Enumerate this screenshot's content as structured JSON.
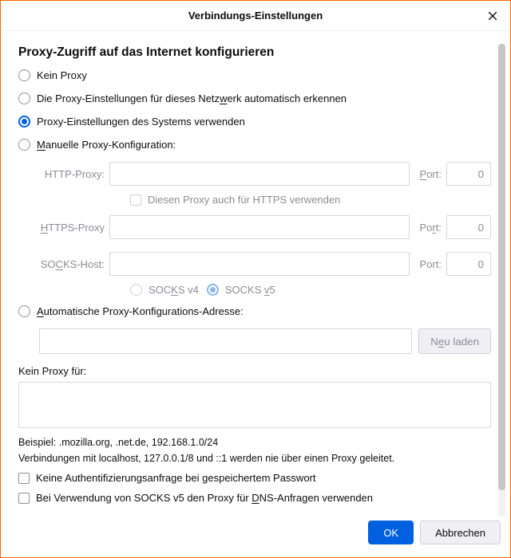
{
  "title": "Verbindungs-Einstellungen",
  "heading": "Proxy-Zugriff auf das Internet konfigurieren",
  "radios": {
    "none": "Kein Proxy",
    "autodetect_pre": "Die Proxy-Einstellungen für dieses Netz",
    "autodetect_u": "w",
    "autodetect_post": "erk automatisch erkennen",
    "system": "Proxy-Einstellungen des Systems verwenden",
    "manual_u": "M",
    "manual_post": "anuelle Proxy-Konfiguration:"
  },
  "proxy": {
    "http_label": "HTTP-Proxy:",
    "https_label_u": "H",
    "https_label_post": "TTPS-Proxy",
    "socks_label": "SO",
    "socks_label_u": "C",
    "socks_label_post": "KS-Host:",
    "port_label_u": "P",
    "port_label_post": "ort:",
    "port_label_plain": "Port:",
    "port_label_plain2": "Po",
    "port_label_u2": "r",
    "port_label_post2": "t:",
    "port_value": "0",
    "share_https": "Diesen Proxy auch für HTTPS verwenden",
    "socks_v4_pre": "SOC",
    "socks_v4_u": "K",
    "socks_v4_post": "S v4",
    "socks_v5_pre": "SOCKS ",
    "socks_v5_u": "v",
    "socks_v5_post": "5"
  },
  "pac": {
    "label_u": "A",
    "label_post": "utomatische Proxy-Konfigurations-Adresse:",
    "reload_pre": "N",
    "reload_u": "e",
    "reload_post": "u laden"
  },
  "noproxy": {
    "label": "Kein Proxy für:",
    "example": "Beispiel: .mozilla.org, .net.de, 192.168.1.0/24",
    "localhost_note": "Verbindungen mit localhost, 127.0.0.1/8 und ::1 werden nie über einen Proxy geleitet."
  },
  "checks": {
    "noauth": "Keine Authentifizierungsanfrage bei gespeichertem Passwort",
    "dns_pre": "Bei Verwendung von SOCKS v5 den Proxy für ",
    "dns_u": "D",
    "dns_post": "NS-Anfragen verwenden"
  },
  "buttons": {
    "ok": "OK",
    "cancel": "Abbrechen"
  }
}
